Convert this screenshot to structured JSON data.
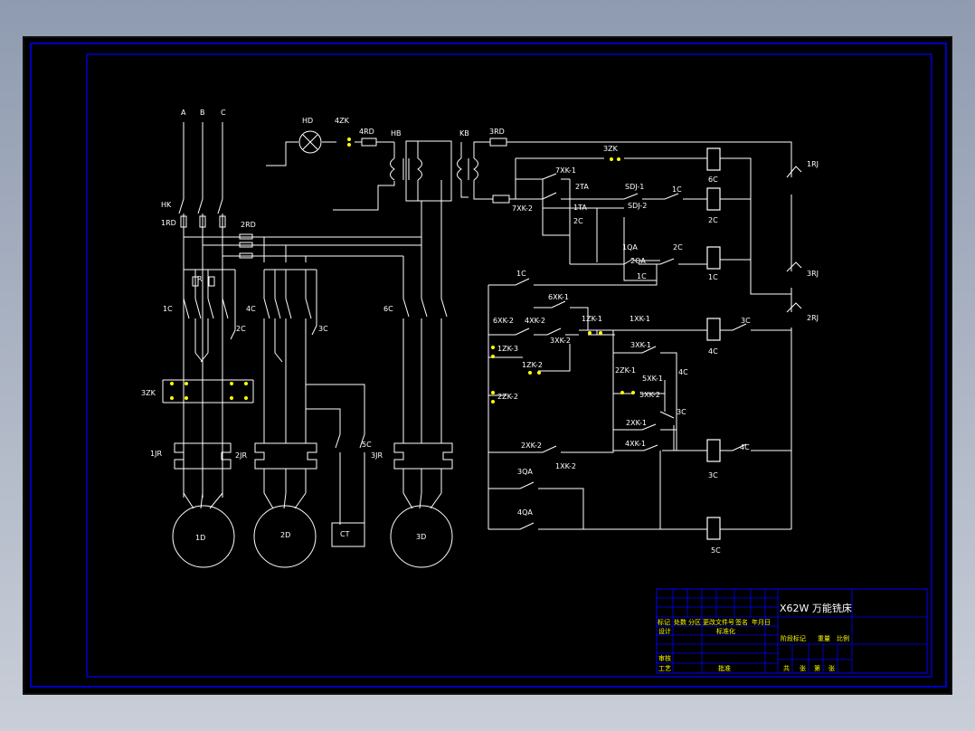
{
  "title_block": {
    "title": "X62W 万能铣床",
    "row_labels": [
      "标记",
      "处数",
      "分区",
      "更改文件号",
      "签名",
      "年月日"
    ],
    "left_labels": [
      "设计",
      "标准化",
      "审核",
      "工艺",
      "批准"
    ],
    "right_labels": [
      "阶段标记",
      "重量",
      "比例"
    ],
    "bottom_labels": [
      "共",
      "张",
      "第",
      "张"
    ]
  },
  "labels": {
    "phase_a": "A",
    "phase_b": "B",
    "phase_c": "C",
    "hk": "HK",
    "rd1": "1RD",
    "rd2": "2RD",
    "rd3": "3RD",
    "rd4": "4RD",
    "hd": "HD",
    "zk4": "4ZK",
    "hb": "HB",
    "kb": "KB",
    "c1_left": "1C",
    "c2_left": "2C",
    "c4_left": "4C",
    "c3_left": "3C",
    "c6_left": "6C",
    "c5_left": "5C",
    "r": "R",
    "zk3_left": "3ZK",
    "jr1": "1JR",
    "jr2": "2JR",
    "jr3": "3JR",
    "m1": "1D",
    "m2": "2D",
    "m3": "3D",
    "ct": "CT",
    "zk3_ctrl": "3ZK",
    "xk7_1": "7XK-1",
    "xk7_2": "7XK-2",
    "ta2": "2TA",
    "ta1": "1TA",
    "sdj1": "SDJ-1",
    "sdj2": "SDJ-2",
    "c1_a": "1C",
    "c2_a": "2C",
    "c2_b": "2C",
    "c6_coil": "6C",
    "c2_coil": "2C",
    "qa1": "1QA",
    "qa2": "2QA",
    "c1_b": "1C",
    "c2_c": "2C",
    "c1_coil": "1C",
    "rj1": "1RJ",
    "rj3": "3RJ",
    "rj2": "2RJ",
    "c1_c": "1C",
    "xk6_1": "6XK-1",
    "xk6_2": "6XK-2",
    "xk4_2": "4XK-2",
    "xk3_2": "3XK-2",
    "zk1_1": "1ZK-1",
    "xk1_1": "1XK-1",
    "c3_a": "3C",
    "c4_coil": "4C",
    "zk1_3": "1ZK-3",
    "xk3_1": "3XK-1",
    "zk1_2": "1ZK-2",
    "zk2_1": "2ZK-1",
    "xk5_1": "5XK-1",
    "c4_a": "4C",
    "xk5_2": "5XK-2",
    "zk2_2": "2ZK-2",
    "c3_b": "3C",
    "xk2_1": "2XK-1",
    "xk4_1": "4XK-1",
    "xk2_2": "2XK-2",
    "xk1_2": "1XK-2",
    "c4_b": "4C",
    "c3_coil": "3C",
    "qa3": "3QA",
    "qa4": "4QA",
    "c5_coil": "5C"
  },
  "colors": {
    "background": "#000000",
    "lines": "#ffffff",
    "frame": "#0000ff",
    "title_grid": "#0000ff",
    "title_text": "#ffff00",
    "contact": "#ffff00"
  }
}
